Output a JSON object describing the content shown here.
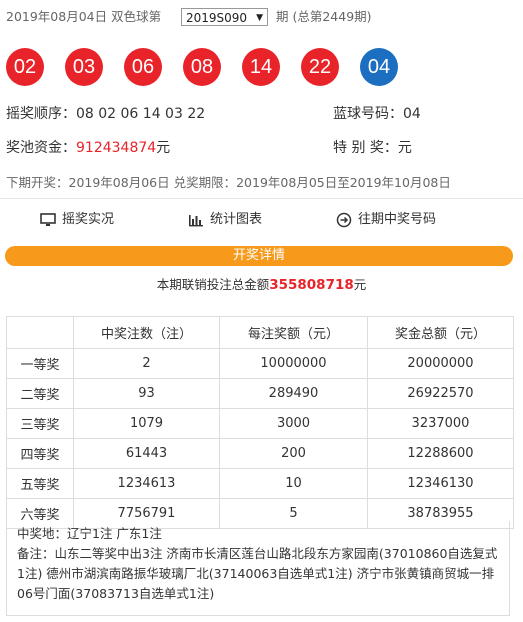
{
  "header": {
    "date_text": "2019年08月04日 双色球第",
    "issue_select": "2019S090",
    "period_text": "期 (总第2449期)"
  },
  "balls": {
    "red": [
      "02",
      "03",
      "06",
      "08",
      "14",
      "22"
    ],
    "blue": [
      "04"
    ],
    "colors": {
      "red": "#e8242a",
      "blue": "#1c6ec0"
    }
  },
  "draw_info": {
    "order_label": "摇奖顺序：",
    "order_value": "08 02 06 14 03 22",
    "blue_label": "蓝球号码：",
    "blue_value": "04",
    "pool_label": "奖池资金：",
    "pool_value": "912434874",
    "pool_unit": "元",
    "special_label": "特 别 奖：",
    "special_value": "元"
  },
  "next_draw": "下期开奖：2019年08月06日 兑奖期限：2019年08月05日至2019年10月08日",
  "links": {
    "live": "摇奖实况",
    "chart": "统计图表",
    "history": "往期中奖号码"
  },
  "details_bar": "开奖详情",
  "sales": {
    "prefix": "本期联销投注总金额",
    "amount": "355808718",
    "suffix": "元"
  },
  "table": {
    "headers": [
      "",
      "中奖注数（注）",
      "每注奖额（元）",
      "奖金总额（元）"
    ],
    "rows": [
      [
        "一等奖",
        "2",
        "10000000",
        "20000000"
      ],
      [
        "二等奖",
        "93",
        "289490",
        "26922570"
      ],
      [
        "三等奖",
        "1079",
        "3000",
        "3237000"
      ],
      [
        "四等奖",
        "61443",
        "200",
        "12288600"
      ],
      [
        "五等奖",
        "1234613",
        "10",
        "12346130"
      ],
      [
        "六等奖",
        "7756791",
        "5",
        "38783955"
      ]
    ]
  },
  "notes": {
    "winners": "中奖地：辽宁1注 广东1注",
    "remark": "备注：山东二等奖中出3注 济南市长清区莲台山路北段东方家园南(37010860自选复式1注) 德州市湖滨南路振华玻璃厂北(37140063自选单式1注) 济宁市张黄镇商贸城一排06号门面(37083713自选单式1注)"
  }
}
